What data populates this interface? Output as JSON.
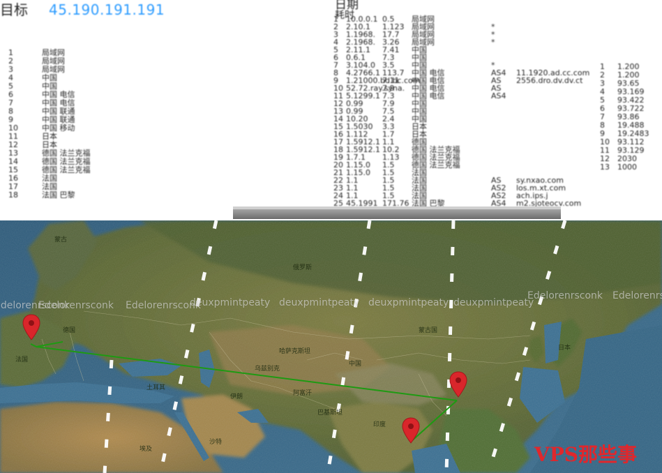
{
  "header": {
    "target_label": "目标",
    "target_ip": "45.190.191.191",
    "date_label": "日期",
    "ttl_label": "耗时"
  },
  "traceroute_rows": [
    {
      "hop": "1",
      "ip": "10.0.0.1",
      "time": "0.5",
      "geo": "局域网",
      "as": "",
      "host": ""
    },
    {
      "hop": "2",
      "ip": "2.10.1",
      "time": "1.123",
      "geo": "局域网",
      "as": "*",
      "host": ""
    },
    {
      "hop": "3",
      "ip": "1.1968.",
      "time": "17.7",
      "geo": "局域网",
      "as": "*",
      "host": ""
    },
    {
      "hop": "4",
      "ip": "2.1968.",
      "time": "3.26",
      "geo": "局域网",
      "as": "*",
      "host": ""
    },
    {
      "hop": "5",
      "ip": "2.11.1",
      "time": "7.41",
      "geo": "中国",
      "as": "",
      "host": ""
    },
    {
      "hop": "6",
      "ip": "0.6.1",
      "time": "7.3",
      "geo": "中国",
      "as": "",
      "host": ""
    },
    {
      "hop": "7",
      "ip": "3.104.0",
      "time": "3.5",
      "geo": "中国",
      "as": "*",
      "host": ""
    },
    {
      "hop": "8",
      "ip": "4.2766.1",
      "time": "113.7",
      "geo": "中国 电信",
      "as": "AS4",
      "host": "11.1920.ad.cc.com"
    },
    {
      "hop": "9",
      "ip": "1.21000.bd.bc.com",
      "time": "7.11",
      "geo": "中国 电信",
      "as": "AS",
      "host": "2556.dro.dv.dv.ct"
    },
    {
      "hop": "10",
      "ip": "52.72.ray.syna.",
      "time": "7.9",
      "geo": "中国 电信",
      "as": "AS",
      "host": ""
    },
    {
      "hop": "11",
      "ip": "5.1299.1",
      "time": "7.3",
      "geo": "中国 电信",
      "as": "AS4",
      "host": ""
    },
    {
      "hop": "12",
      "ip": "0.99",
      "time": "7.9",
      "geo": "中国",
      "as": "",
      "host": ""
    },
    {
      "hop": "13",
      "ip": "0.99",
      "time": "7.5",
      "geo": "中国",
      "as": "",
      "host": ""
    },
    {
      "hop": "14",
      "ip": "10.20",
      "time": "2.4",
      "geo": "中国",
      "as": "",
      "host": ""
    },
    {
      "hop": "15",
      "ip": "1.5030",
      "time": "3.3",
      "geo": "日本",
      "as": "",
      "host": ""
    },
    {
      "hop": "16",
      "ip": "1.112",
      "time": "1.7",
      "geo": "日本",
      "as": "",
      "host": ""
    },
    {
      "hop": "17",
      "ip": "1.5912.1",
      "time": "1.1",
      "geo": "德国",
      "as": "",
      "host": ""
    },
    {
      "hop": "18",
      "ip": "1.5912.1",
      "time": "10.2",
      "geo": "德国 法兰克福",
      "as": "",
      "host": ""
    },
    {
      "hop": "19",
      "ip": "1.7.1",
      "time": "1.13",
      "geo": "德国 法兰克福",
      "as": "",
      "host": ""
    },
    {
      "hop": "20",
      "ip": "1.15.0",
      "time": "1.5",
      "geo": "德国 法兰克福",
      "as": "",
      "host": ""
    },
    {
      "hop": "21",
      "ip": "1.15.0",
      "time": "1.5",
      "geo": "法国",
      "as": "",
      "host": ""
    },
    {
      "hop": "22",
      "ip": "1.1",
      "time": "1.5",
      "geo": "法国",
      "as": "AS",
      "host": "sy.nxao.com"
    },
    {
      "hop": "23",
      "ip": "1.1",
      "time": "1.5",
      "geo": "法国",
      "as": "AS2",
      "host": "los.m.xt.com"
    },
    {
      "hop": "24",
      "ip": "1.1",
      "time": "1.5",
      "geo": "法国",
      "as": "AS2",
      "host": "ach.ips.j"
    },
    {
      "hop": "25",
      "ip": "45.1991",
      "time": "171.76",
      "geo": "法国 巴黎",
      "as": "AS4",
      "host": "m2.sjoteocv.com"
    }
  ],
  "left_panel_rows": [
    {
      "hop": "1",
      "geo": "局域网"
    },
    {
      "hop": "2",
      "geo": "局域网"
    },
    {
      "hop": "3",
      "geo": "局域网"
    },
    {
      "hop": "4",
      "geo": "中国"
    },
    {
      "hop": "5",
      "geo": "中国"
    },
    {
      "hop": "6",
      "geo": "中国 电信"
    },
    {
      "hop": "7",
      "geo": "中国 电信"
    },
    {
      "hop": "8",
      "geo": "中国 联通"
    },
    {
      "hop": "9",
      "geo": "中国 联通"
    },
    {
      "hop": "10",
      "geo": "中国 移动"
    },
    {
      "hop": "11",
      "geo": "日本"
    },
    {
      "hop": "12",
      "geo": "日本"
    },
    {
      "hop": "13",
      "geo": "德国 法兰克福"
    },
    {
      "hop": "14",
      "geo": "德国 法兰克福"
    },
    {
      "hop": "15",
      "geo": "德国 法兰克福"
    },
    {
      "hop": "16",
      "geo": "法国"
    },
    {
      "hop": "17",
      "geo": "法国"
    },
    {
      "hop": "18",
      "geo": "法国 巴黎"
    }
  ],
  "right_panel_rows": [
    {
      "hop": "1",
      "time": "1.200"
    },
    {
      "hop": "2",
      "time": "1.200"
    },
    {
      "hop": "3",
      "time": "93.65"
    },
    {
      "hop": "4",
      "time": "93.169"
    },
    {
      "hop": "5",
      "time": "93.422"
    },
    {
      "hop": "6",
      "time": "93.722"
    },
    {
      "hop": "7",
      "time": "93.86"
    },
    {
      "hop": "8",
      "time": "19.488"
    },
    {
      "hop": "9",
      "time": "19.2483"
    },
    {
      "hop": "10",
      "time": "93.112"
    },
    {
      "hop": "11",
      "time": "93.129"
    },
    {
      "hop": "12",
      "time": "2030"
    },
    {
      "hop": "13",
      "time": "1000"
    }
  ],
  "map": {
    "route_color": "#1e9a12",
    "pin_color": "#d9262b",
    "overlay_texts": [
      {
        "text": "Edelorenrsconk"
      },
      {
        "text": "Edelorenrsconk"
      },
      {
        "text": "Edelorenrsconk"
      },
      {
        "text": "deuxpmintpeaty"
      },
      {
        "text": "deuxpmintpeaty"
      },
      {
        "text": "deuxpmintpeaty"
      },
      {
        "text": "deuxpmintpeaty"
      },
      {
        "text": "Edelorenrsconk"
      },
      {
        "text": "Edelorenrsconk"
      }
    ],
    "place_labels": [
      {
        "text": "蒙古"
      },
      {
        "text": "中国"
      },
      {
        "text": "印度"
      },
      {
        "text": "日本"
      },
      {
        "text": "俄罗斯"
      },
      {
        "text": "哈萨克斯坦"
      },
      {
        "text": "伊朗"
      },
      {
        "text": "土耳其"
      },
      {
        "text": "德国"
      },
      {
        "text": "法国"
      },
      {
        "text": "埃及"
      },
      {
        "text": "沙特"
      },
      {
        "text": "阿富汗"
      },
      {
        "text": "巴基斯坦"
      },
      {
        "text": "乌兹别克"
      },
      {
        "text": "蒙古国"
      }
    ],
    "pins": [
      {
        "name": "paris-pin"
      },
      {
        "name": "china-pin"
      },
      {
        "name": "india-pin"
      }
    ]
  },
  "watermark": {
    "text": "VPS那些事"
  }
}
